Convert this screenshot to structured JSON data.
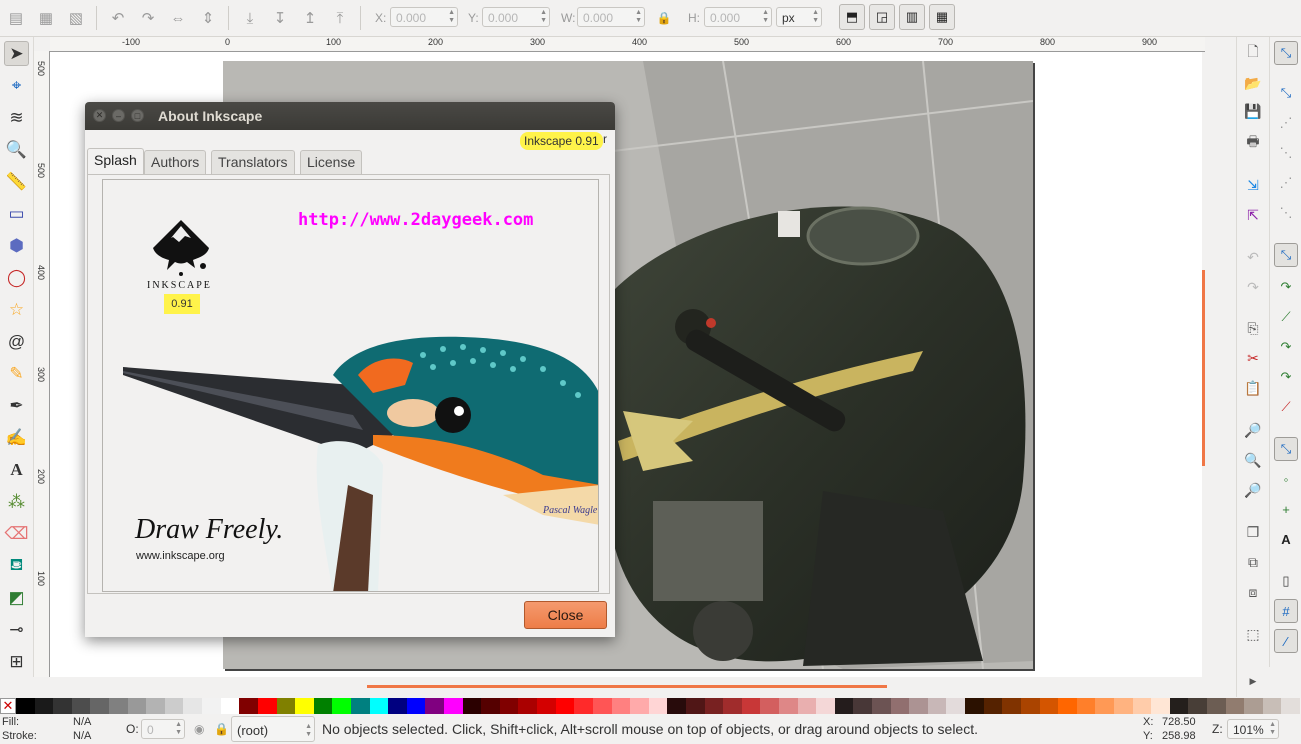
{
  "toolbar": {
    "x_label": "X:",
    "x_value": "0.000",
    "y_label": "Y:",
    "y_value": "0.000",
    "w_label": "W:",
    "w_value": "0.000",
    "h_label": "H:",
    "h_value": "0.000",
    "unit": "px"
  },
  "ruler": {
    "h_ticks": [
      "-100",
      "0",
      "100",
      "200",
      "300",
      "400",
      "500",
      "600",
      "700",
      "800",
      "900"
    ],
    "v_ticks": [
      "500",
      "400",
      "300",
      "200",
      "100"
    ]
  },
  "dialog": {
    "title": "About Inkscape",
    "version_label": "Inkscape 0.91",
    "version_trail": "r",
    "tabs": [
      "Splash",
      "Authors",
      "Translators",
      "License"
    ],
    "active_tab": "Splash",
    "close_label": "Close"
  },
  "splash": {
    "url_watermark": "http://www.2daygeek.com",
    "logo_name": "INKSCAPE",
    "logo_version": "0.91",
    "tagline": "Draw Freely.",
    "site": "www.inkscape.org",
    "signature": "Pascal Wagle"
  },
  "status": {
    "fill_label": "Fill:",
    "fill_value": "N/A",
    "stroke_label": "Stroke:",
    "stroke_value": "N/A",
    "opacity_label": "O:",
    "opacity_value": "0",
    "layer": "(root)",
    "message": "No objects selected. Click, Shift+click, Alt+scroll mouse on top of objects, or drag around objects to select.",
    "cursor_x_label": "X:",
    "cursor_x": "728.50",
    "cursor_y_label": "Y:",
    "cursor_y": "258.98",
    "zoom_label": "Z:",
    "zoom": "101%"
  },
  "palette": [
    "#000000",
    "#1a1a1a",
    "#333333",
    "#4d4d4d",
    "#666666",
    "#808080",
    "#999999",
    "#b3b3b3",
    "#cccccc",
    "#e6e6e6",
    "#f2f2f2",
    "#ffffff",
    "#800000",
    "#ff0000",
    "#808000",
    "#ffff00",
    "#008000",
    "#00ff00",
    "#008080",
    "#00ffff",
    "#000080",
    "#0000ff",
    "#800080",
    "#ff00ff",
    "#2b0000",
    "#550000",
    "#800000",
    "#aa0000",
    "#d40000",
    "#ff0000",
    "#ff2a2a",
    "#ff5555",
    "#ff8080",
    "#ffaaaa",
    "#ffd5d5",
    "#280b0b",
    "#501616",
    "#782121",
    "#a02c2c",
    "#c83737",
    "#d35f5f",
    "#de8787",
    "#e9afaf",
    "#f4d7d7",
    "#241c1c",
    "#483737",
    "#6c5353",
    "#916f6f",
    "#ac9393",
    "#c8b7b7",
    "#e3dbdb",
    "#2b1100",
    "#552200",
    "#803300",
    "#aa4400",
    "#d45500",
    "#ff6600",
    "#ff7f2a",
    "#ff9955",
    "#ffb380",
    "#ffccaa",
    "#ffe6d5",
    "#241f1c",
    "#483e37",
    "#6c5d53",
    "#917c6f",
    "#ac9d93",
    "#c8beb7",
    "#e3dedb"
  ]
}
